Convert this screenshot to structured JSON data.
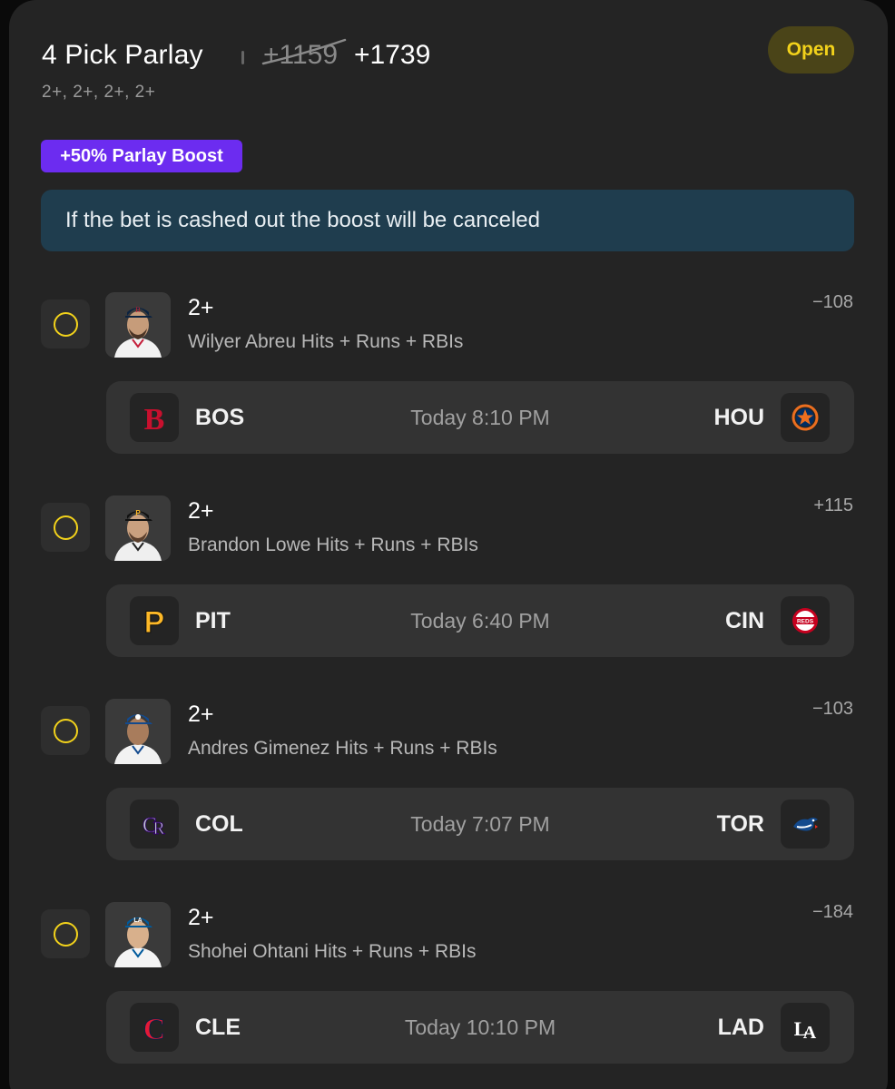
{
  "header": {
    "title": "4 Pick Parlay",
    "old_odds": "+1159",
    "new_odds": "+1739",
    "subtitle": "2+, 2+, 2+, 2+",
    "status": "Open"
  },
  "boost": {
    "label": "+50% Parlay Boost",
    "notice": "If the bet is cashed out the boost will be canceled"
  },
  "colors": {
    "accent_yellow": "#f2d21b",
    "boost_purple": "#6c2cf0",
    "notice_bg": "#1f3d4e"
  },
  "legs": [
    {
      "line": "2+",
      "market": "Wilyer Abreu Hits + Runs + RBIs",
      "odds": "−108",
      "game": {
        "away": "BOS",
        "time": "Today 8:10 PM",
        "home": "HOU"
      },
      "away_icon": "red-sox-logo-icon",
      "home_icon": "astros-logo-icon"
    },
    {
      "line": "2+",
      "market": "Brandon Lowe Hits + Runs + RBIs",
      "odds": "+115",
      "game": {
        "away": "PIT",
        "time": "Today 6:40 PM",
        "home": "CIN"
      },
      "away_icon": "pirates-logo-icon",
      "home_icon": "reds-logo-icon"
    },
    {
      "line": "2+",
      "market": "Andres Gimenez Hits + Runs + RBIs",
      "odds": "−103",
      "game": {
        "away": "COL",
        "time": "Today 7:07 PM",
        "home": "TOR"
      },
      "away_icon": "rockies-logo-icon",
      "home_icon": "blue-jays-logo-icon"
    },
    {
      "line": "2+",
      "market": "Shohei Ohtani Hits + Runs + RBIs",
      "odds": "−184",
      "game": {
        "away": "CLE",
        "time": "Today 10:10 PM",
        "home": "LAD"
      },
      "away_icon": "guardians-logo-icon",
      "home_icon": "dodgers-logo-icon"
    }
  ]
}
